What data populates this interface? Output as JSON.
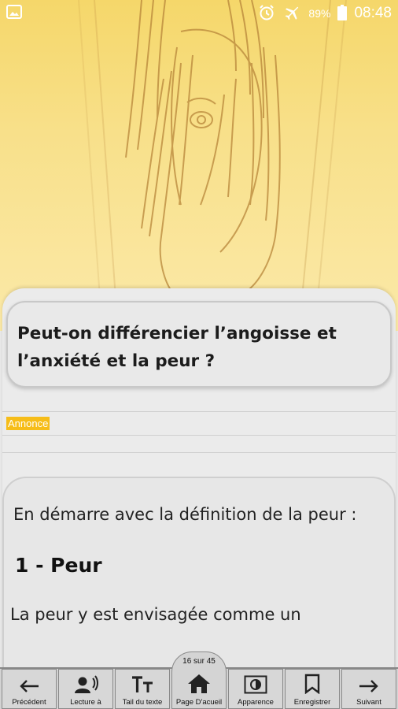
{
  "status_bar": {
    "battery": "89%",
    "time": "08:48"
  },
  "article": {
    "title": "Peut-on différencier l’angoisse et l’anxiété et la peur ?",
    "ad_label": "Annonce",
    "intro": "En démarre avec la définition de la peur :",
    "section_heading": "1 - Peur",
    "body_start": "La peur y est envisagée comme un"
  },
  "nav": {
    "previous": "Précédent",
    "read": "Lecture à",
    "text_size": "Tail du texte",
    "home": "Page D'acueil",
    "page_counter": "16 sur 45",
    "appearance": "Apparence",
    "save": "Enregistrer",
    "next": "Suivant"
  },
  "colors": {
    "hero_yellow": "#f5d76a",
    "ad_badge": "#f6bd19",
    "sheet_bg": "#ebebeb"
  }
}
